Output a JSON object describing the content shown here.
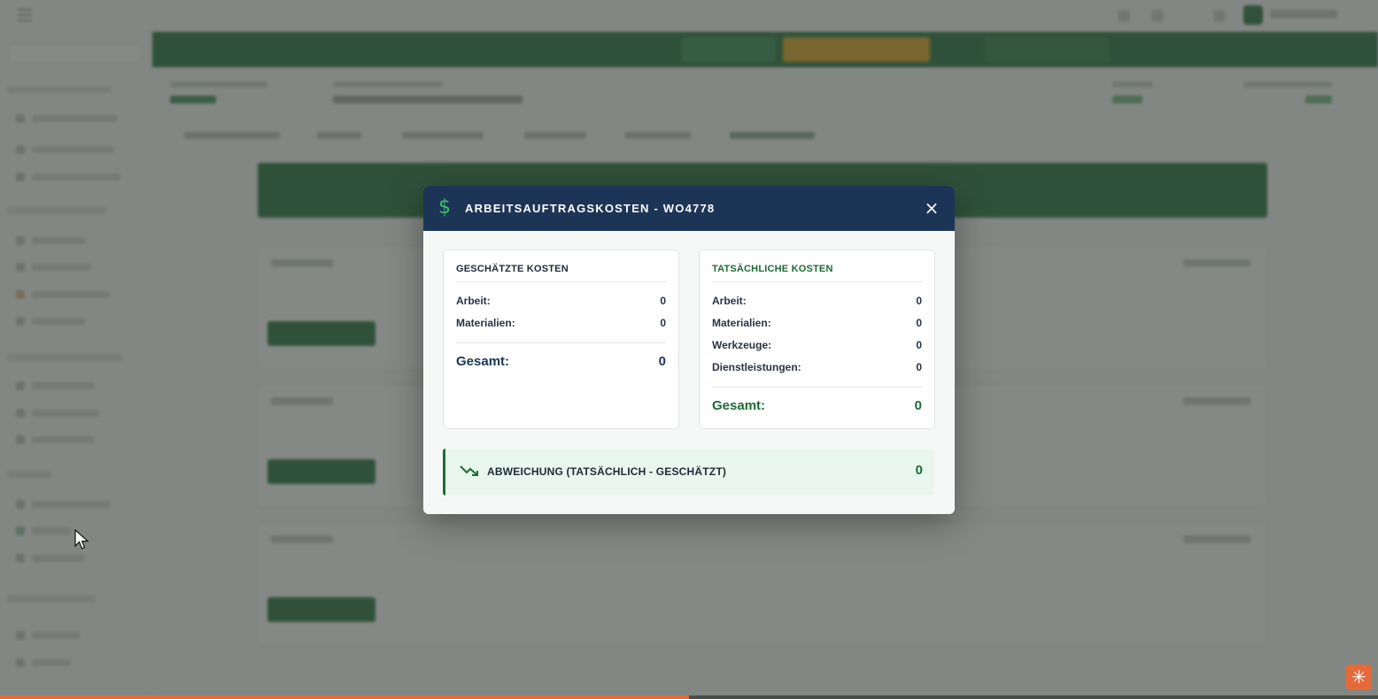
{
  "modal": {
    "title": "ARBEITSAUFTRAGSKOSTEN - WO4778",
    "close_label": "×",
    "icon": "dollar-icon",
    "estimated": {
      "heading": "GESCHÄTZTE KOSTEN",
      "rows": [
        {
          "label": "Arbeit:",
          "value": "0"
        },
        {
          "label": "Materialien:",
          "value": "0"
        }
      ],
      "total_label": "Gesamt:",
      "total_value": "0"
    },
    "actual": {
      "heading": "TATSÄCHLICHE KOSTEN",
      "rows": [
        {
          "label": "Arbeit:",
          "value": "0"
        },
        {
          "label": "Materialien:",
          "value": "0"
        },
        {
          "label": "Werkzeuge:",
          "value": "0"
        },
        {
          "label": "Dienstleistungen:",
          "value": "0"
        }
      ],
      "total_label": "Gesamt:",
      "total_value": "0"
    },
    "variance": {
      "label": "ABWEICHUNG (TATSÄCHLICH - GESCHÄTZT)",
      "value": "0",
      "icon": "trending-down-icon"
    }
  },
  "colors": {
    "header_bg": "#1c3557",
    "accent_green": "#1e6b34",
    "estimated_heading": "#1e2a36",
    "actual_heading": "#1e6b34",
    "variance_bg": "#e8f6ed",
    "fab": "#e56a3a"
  },
  "progress": {
    "value": 0.5
  },
  "fab": {
    "icon": "asterisk-icon",
    "glyph": "✳"
  }
}
